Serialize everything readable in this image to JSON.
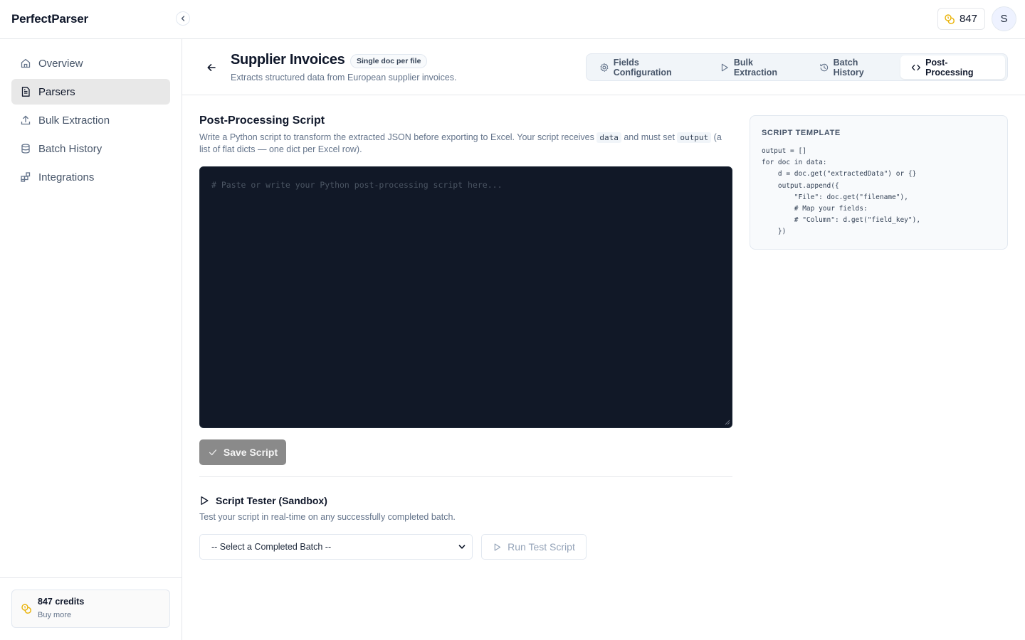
{
  "app": {
    "brand": "PerfectParser",
    "credits": "847",
    "avatar_initial": "S"
  },
  "sidebar": {
    "items": [
      {
        "label": "Overview",
        "icon": "home-icon",
        "active": false
      },
      {
        "label": "Parsers",
        "icon": "file-text-icon",
        "active": true
      },
      {
        "label": "Bulk Extraction",
        "icon": "upload-icon",
        "active": false
      },
      {
        "label": "Batch History",
        "icon": "database-icon",
        "active": false
      },
      {
        "label": "Integrations",
        "icon": "blocks-icon",
        "active": false
      }
    ],
    "credit_card": {
      "title": "847 credits",
      "link": "Buy more"
    }
  },
  "header": {
    "title": "Supplier Invoices",
    "badge": "Single doc per file",
    "subtitle": "Extracts structured data from European supplier invoices.",
    "tabs": [
      {
        "label": "Fields Configuration",
        "icon": "gear-icon",
        "active": false
      },
      {
        "label": "Bulk Extraction",
        "icon": "play-icon",
        "active": false
      },
      {
        "label": "Batch History",
        "icon": "history-icon",
        "active": false
      },
      {
        "label": "Post-Processing",
        "icon": "code-icon",
        "active": true
      }
    ]
  },
  "script": {
    "title": "Post-Processing Script",
    "desc_part1": "Write a Python script to transform the extracted JSON before exporting to Excel. Your script receives",
    "desc_code1": "data",
    "desc_part2": "and must set",
    "desc_code2": "output",
    "desc_part3": "(a list of flat dicts — one dict per Excel row).",
    "editor_value": "",
    "editor_placeholder": "# Paste or write your Python post-processing script here...",
    "save_label": "Save Script"
  },
  "tester": {
    "title": "Script Tester (Sandbox)",
    "desc": "Test your script in real-time on any successfully completed batch.",
    "select_value": "-- Select a Completed Batch --",
    "run_label": "Run Test Script"
  },
  "template": {
    "heading": "SCRIPT TEMPLATE",
    "lines": [
      "output = []",
      "for doc in data:",
      "    d = doc.get(\"extractedData\") or {}",
      "    output.append({",
      "        \"File\": doc.get(\"filename\"),",
      "        # Map your fields:",
      "        # \"Column\": d.get(\"field_key\"),",
      "    })"
    ]
  },
  "colors": {
    "editor_bg": "#111827",
    "accent_coin": "#eab308",
    "save_disabled": "#8a8a8a",
    "active_nav": "#e8e8e8"
  }
}
